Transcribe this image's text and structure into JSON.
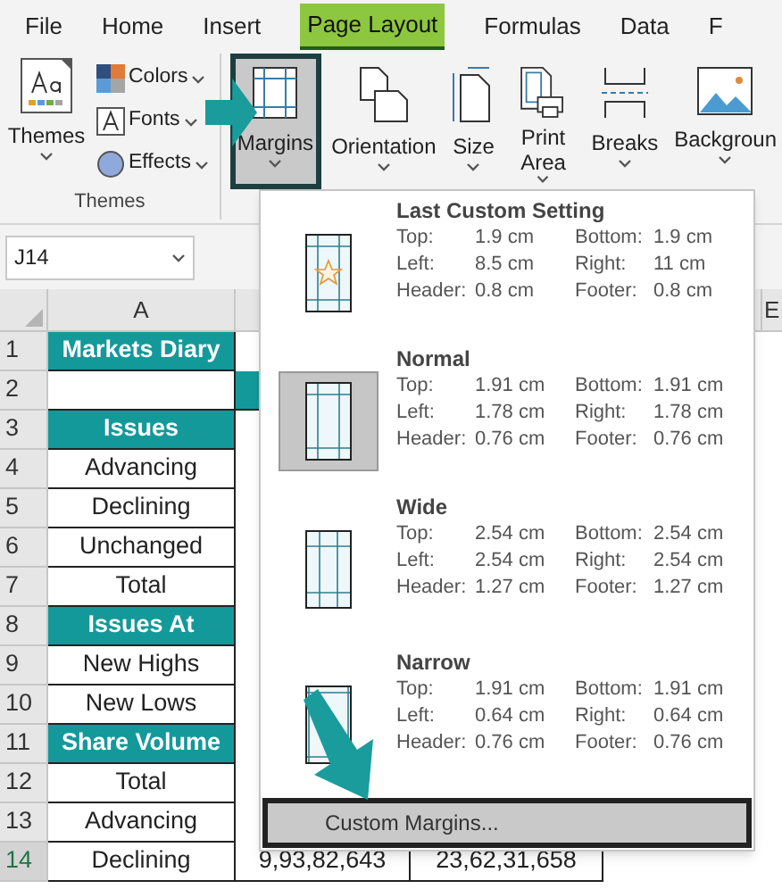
{
  "tabs": [
    {
      "label": "File",
      "selected": false
    },
    {
      "label": "Home",
      "selected": false
    },
    {
      "label": "Insert",
      "selected": false
    },
    {
      "label": "Page Layout",
      "selected": true
    },
    {
      "label": "Formulas",
      "selected": false
    },
    {
      "label": "Data",
      "selected": false
    },
    {
      "label": "F",
      "selected": false
    }
  ],
  "ribbon": {
    "themes_button": "Themes",
    "theme_items": [
      {
        "kind": "colors",
        "label": "Colors"
      },
      {
        "kind": "fonts",
        "label": "Fonts"
      },
      {
        "kind": "effects",
        "label": "Effects"
      }
    ],
    "group_label": "Themes",
    "buttons": [
      {
        "kind": "margins",
        "label": "Margins",
        "selected": true
      },
      {
        "kind": "orientation",
        "label": "Orientation",
        "selected": false
      },
      {
        "kind": "size",
        "label": "Size",
        "selected": false
      },
      {
        "kind": "print_area",
        "label": "Print Area",
        "selected": false
      },
      {
        "kind": "breaks",
        "label": "Breaks",
        "selected": false
      },
      {
        "kind": "background",
        "label": "Backgroun",
        "selected": false
      }
    ]
  },
  "name_box": "J14",
  "columns": [
    "A",
    "E"
  ],
  "rows": [
    {
      "num": "1",
      "selected": false,
      "cells": [
        {
          "kind": "heading",
          "text": "Markets Diary"
        }
      ]
    },
    {
      "num": "2",
      "selected": false,
      "cells": [
        {
          "kind": "blank"
        },
        {
          "kind": "heading"
        }
      ]
    },
    {
      "num": "3",
      "selected": false,
      "cells": [
        {
          "kind": "heading",
          "text": "Issues"
        }
      ]
    },
    {
      "num": "4",
      "selected": false,
      "cells": [
        {
          "kind": "plain",
          "text": "Advancing"
        }
      ]
    },
    {
      "num": "5",
      "selected": false,
      "cells": [
        {
          "kind": "plain",
          "text": "Declining"
        }
      ]
    },
    {
      "num": "6",
      "selected": false,
      "cells": [
        {
          "kind": "plain",
          "text": "Unchanged"
        }
      ]
    },
    {
      "num": "7",
      "selected": false,
      "cells": [
        {
          "kind": "plain",
          "text": "Total"
        }
      ]
    },
    {
      "num": "8",
      "selected": false,
      "cells": [
        {
          "kind": "heading",
          "text": "Issues At"
        }
      ]
    },
    {
      "num": "9",
      "selected": false,
      "cells": [
        {
          "kind": "plain",
          "text": "New Highs"
        }
      ]
    },
    {
      "num": "10",
      "selected": false,
      "cells": [
        {
          "kind": "plain",
          "text": "New Lows"
        }
      ]
    },
    {
      "num": "11",
      "selected": false,
      "cells": [
        {
          "kind": "heading",
          "text": "Share Volume"
        }
      ]
    },
    {
      "num": "12",
      "selected": false,
      "cells": [
        {
          "kind": "plain",
          "text": "Total"
        }
      ]
    },
    {
      "num": "13",
      "selected": false,
      "cells": [
        {
          "kind": "plain",
          "text": "Advancing"
        }
      ]
    },
    {
      "num": "14",
      "selected": true,
      "cells": [
        {
          "kind": "plain",
          "text": "Declining"
        },
        {
          "kind": "plain",
          "text": "9,93,82,643"
        },
        {
          "kind": "plain",
          "text": "23,62,31,658"
        }
      ]
    }
  ],
  "margins_menu": {
    "options": [
      {
        "kind": "last_custom",
        "title": "Last Custom Setting",
        "selected": false,
        "fields": [
          {
            "label": "Top:",
            "value": "1.9 cm"
          },
          {
            "label": "Bottom:",
            "value": "1.9 cm"
          },
          {
            "label": "Left:",
            "value": "8.5 cm"
          },
          {
            "label": "Right:",
            "value": "11 cm"
          },
          {
            "label": "Header:",
            "value": "0.8 cm"
          },
          {
            "label": "Footer:",
            "value": "0.8 cm"
          }
        ]
      },
      {
        "kind": "normal",
        "title": "Normal",
        "selected": true,
        "fields": [
          {
            "label": "Top:",
            "value": "1.91 cm"
          },
          {
            "label": "Bottom:",
            "value": "1.91 cm"
          },
          {
            "label": "Left:",
            "value": "1.78 cm"
          },
          {
            "label": "Right:",
            "value": "1.78 cm"
          },
          {
            "label": "Header:",
            "value": "0.76 cm"
          },
          {
            "label": "Footer:",
            "value": "0.76 cm"
          }
        ]
      },
      {
        "kind": "wide",
        "title": "Wide",
        "selected": false,
        "fields": [
          {
            "label": "Top:",
            "value": "2.54 cm"
          },
          {
            "label": "Bottom:",
            "value": "2.54 cm"
          },
          {
            "label": "Left:",
            "value": "2.54 cm"
          },
          {
            "label": "Right:",
            "value": "2.54 cm"
          },
          {
            "label": "Header:",
            "value": "1.27 cm"
          },
          {
            "label": "Footer:",
            "value": "1.27 cm"
          }
        ]
      },
      {
        "kind": "narrow",
        "title": "Narrow",
        "selected": false,
        "fields": [
          {
            "label": "Top:",
            "value": "1.91 cm"
          },
          {
            "label": "Bottom:",
            "value": "1.91 cm"
          },
          {
            "label": "Left:",
            "value": "0.64 cm"
          },
          {
            "label": "Right:",
            "value": "0.64 cm"
          },
          {
            "label": "Header:",
            "value": "0.76 cm"
          },
          {
            "label": "Footer:",
            "value": "0.76 cm"
          }
        ]
      }
    ],
    "custom_button": "Custom Margins..."
  }
}
